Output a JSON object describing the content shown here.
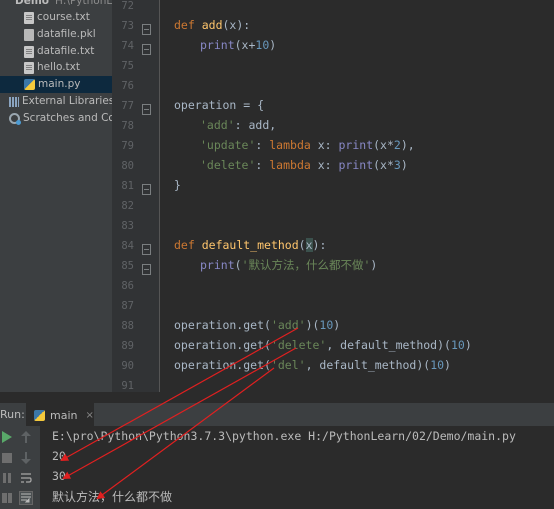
{
  "project": {
    "root_label": "Demo",
    "root_path": "H:\\PythonLe",
    "files": [
      {
        "name": "course.txt",
        "icon": "text-file-icon"
      },
      {
        "name": "datafile.pkl",
        "icon": "pickle-file-icon"
      },
      {
        "name": "datafile.txt",
        "icon": "text-file-icon"
      },
      {
        "name": "hello.txt",
        "icon": "text-file-icon"
      },
      {
        "name": "main.py",
        "icon": "python-file-icon"
      }
    ],
    "external_libraries": "External Libraries",
    "scratches": "Scratches and Consoles"
  },
  "editor": {
    "line_numbers": [
      "72",
      "73",
      "74",
      "75",
      "76",
      "77",
      "78",
      "79",
      "80",
      "81",
      "82",
      "83",
      "84",
      "85",
      "86",
      "87",
      "88",
      "89",
      "90",
      "91"
    ],
    "code": {
      "l73": {
        "kw": "def",
        "name": "add",
        "rest": "(x):"
      },
      "l74": {
        "call": "print",
        "rest": "(x+",
        "num": "10",
        "close": ")"
      },
      "l77": "operation = {",
      "l78": {
        "key": "'add'",
        "rest": ": add,"
      },
      "l79": {
        "key": "'update'",
        "colon": ": ",
        "kw": "lambda",
        "rest": " x: ",
        "call": "print",
        "args": "(x*",
        "num": "2",
        "close": "),"
      },
      "l80": {
        "key": "'delete'",
        "colon": ": ",
        "kw": "lambda",
        "rest": " x: ",
        "call": "print",
        "args": "(x*",
        "num": "3",
        "close": ")"
      },
      "l81": "}",
      "l84": {
        "kw": "def",
        "name": "default_method",
        "open": "(",
        "param": "x",
        "close": "):"
      },
      "l85": {
        "call": "print",
        "open": "(",
        "str": "'默认方法，什么都不做'",
        "close": ")"
      },
      "l88": {
        "pre": "operation.get(",
        "str": "'add'",
        "post": ")(",
        "num": "10",
        "close": ")"
      },
      "l89": {
        "pre": "operation.get(",
        "str": "'delete'",
        "post": ", default_method)(",
        "num": "10",
        "close": ")"
      },
      "l90": {
        "pre": "operation.get(",
        "str": "'del'",
        "post": ", default_method)(",
        "num": "10",
        "close": ")"
      }
    }
  },
  "run": {
    "label": "Run:",
    "tab_label": "main",
    "close_symbol": "×",
    "command": "E:\\pro\\Python\\Python3.7.3\\python.exe H:/PythonLearn/02/Demo/main.py",
    "output": [
      "20",
      "30",
      "默认方法，什么都不做"
    ]
  },
  "colors": {
    "annotation_arrow": "#e02020",
    "run_icon": "#59a869"
  }
}
